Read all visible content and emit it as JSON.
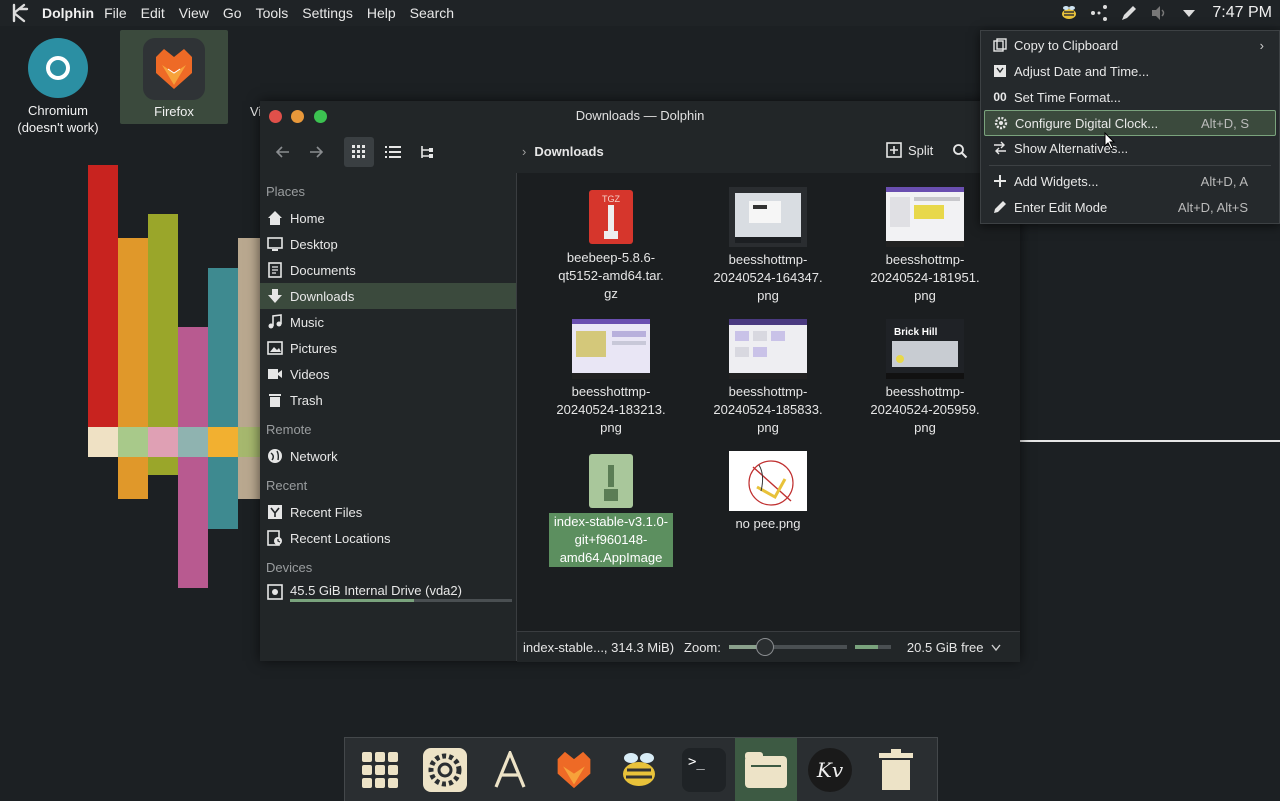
{
  "panel": {
    "app_name": "Dolphin",
    "menus": [
      "File",
      "Edit",
      "View",
      "Go",
      "Tools",
      "Settings",
      "Help",
      "Search"
    ],
    "clock": "7:47 PM",
    "tray_icons": [
      "beebeep-icon",
      "network-icon",
      "pen-icon",
      "volume-muted-icon",
      "arrow-down-icon"
    ]
  },
  "desktop": {
    "icons": [
      {
        "label": "Chromium\n(doesn't work)"
      },
      {
        "label": "Firefox"
      },
      {
        "label": "Vi"
      }
    ]
  },
  "dolphin": {
    "title": "Downloads — Dolphin",
    "breadcrumb": "Downloads",
    "split_label": "Split",
    "places": {
      "places_header": "Places",
      "places": [
        "Home",
        "Desktop",
        "Documents",
        "Downloads",
        "Music",
        "Pictures",
        "Videos",
        "Trash"
      ],
      "remote_header": "Remote",
      "remote": [
        "Network"
      ],
      "recent_header": "Recent",
      "recent": [
        "Recent Files",
        "Recent Locations"
      ],
      "devices_header": "Devices",
      "devices": [
        "45.5 GiB Internal Drive (vda2)"
      ]
    },
    "drive_usage": 0.56,
    "files": [
      {
        "name": "beebeep-5.8.6-qt5152-amd64.tar.gz",
        "line1": "beebeep-5.8.6-",
        "line2": "qt5152-amd64.tar.",
        "line3": "gz",
        "badge": "TGZ"
      },
      {
        "name": "beesshottmp-20240524-164347.png",
        "line1": "beesshottmp-",
        "line2": "20240524-164347.",
        "line3": "png"
      },
      {
        "name": "beesshottmp-20240524-181951.png",
        "line1": "beesshottmp-",
        "line2": "20240524-181951.",
        "line3": "png"
      },
      {
        "name": "beesshottmp-20240524-183213.png",
        "line1": "beesshottmp-",
        "line2": "20240524-183213.",
        "line3": "png"
      },
      {
        "name": "beesshottmp-20240524-185833.png",
        "line1": "beesshottmp-",
        "line2": "20240524-185833.",
        "line3": "png"
      },
      {
        "name": "beesshottmp-20240524-205959.png",
        "line1": "beesshottmp-",
        "line2": "20240524-205959.",
        "line3": "png",
        "thumb_text": "Brick Hill"
      },
      {
        "name": "index-stable-v3.1.0-git+f960148-amd64.AppImage",
        "line1": "index-stable-v3.1.0-",
        "line2": "git+f960148-",
        "line3": "amd64.AppImage"
      },
      {
        "name": "no pee.png",
        "line1": "no pee.png",
        "line2": "",
        "line3": ""
      }
    ],
    "status": {
      "selection": "index-stable..., 314.3 MiB)",
      "zoom_label": "Zoom:",
      "zoom_level": 0.3,
      "free_space": "20.5 GiB free",
      "free_fraction": 0.65
    }
  },
  "context_menu": {
    "items": [
      {
        "label": "Copy to Clipboard",
        "shortcut": "",
        "submenu": true
      },
      {
        "label": "Adjust Date and Time...",
        "shortcut": ""
      },
      {
        "label": "Set Time Format...",
        "shortcut": "",
        "icon_text": "00"
      },
      {
        "label": "Configure Digital Clock...",
        "shortcut": "Alt+D, S"
      },
      {
        "label": "Show Alternatives...",
        "shortcut": ""
      },
      {
        "label": "Add Widgets...",
        "shortcut": "Alt+D, A"
      },
      {
        "label": "Enter Edit Mode",
        "shortcut": "Alt+D, Alt+S"
      }
    ]
  },
  "dock": {
    "apps": [
      "app-grid-icon",
      "settings-icon",
      "font-icon",
      "firefox-icon",
      "beebeep-icon",
      "terminal-icon",
      "file-manager-icon",
      "kv-icon",
      "trash-icon"
    ],
    "terminal_text": ">_",
    "kv_text": "Kv"
  },
  "colors": {
    "accent": "#7aa37d",
    "selection": "#3b4a3d",
    "panel": "#1f2326",
    "window_close": "#e0504a",
    "window_min": "#e8983a",
    "window_max": "#3cc251"
  }
}
